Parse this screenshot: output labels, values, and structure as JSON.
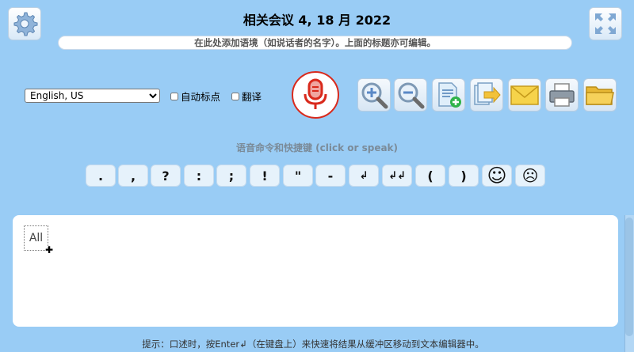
{
  "header": {
    "title": "相关会议 4, 18 月 2022",
    "context": "在此处添加语境（如说话者的名字）。上面的标题亦可编辑。"
  },
  "controls": {
    "language": "English, US",
    "language_options": [
      "English, US"
    ],
    "auto_punctuation": "自动标点",
    "translate": "翻译"
  },
  "commands": {
    "label": "语音命令和快捷键 (click or speak)",
    "buttons": [
      ".",
      ",",
      "?",
      ":",
      ";",
      "!",
      "\"",
      "-",
      "↲",
      "↲↲",
      "(",
      ")",
      "☺",
      "☹"
    ]
  },
  "editor": {
    "all_label": "All",
    "cursor": "✚"
  },
  "footer": {
    "tip": "提示：口述时，按Enter↲（在键盘上）来快速将结果从缓冲区移动到文本编辑器中。"
  },
  "colors": {
    "background": "#99ccf5",
    "mic_ring": "#d92a1c",
    "button_bg": "#e6f2fb"
  },
  "icons": [
    "gear-icon",
    "fullscreen-icon",
    "microphone-icon",
    "zoom-in-icon",
    "zoom-out-icon",
    "new-document-icon",
    "export-icon",
    "email-icon",
    "print-icon",
    "folder-icon"
  ]
}
